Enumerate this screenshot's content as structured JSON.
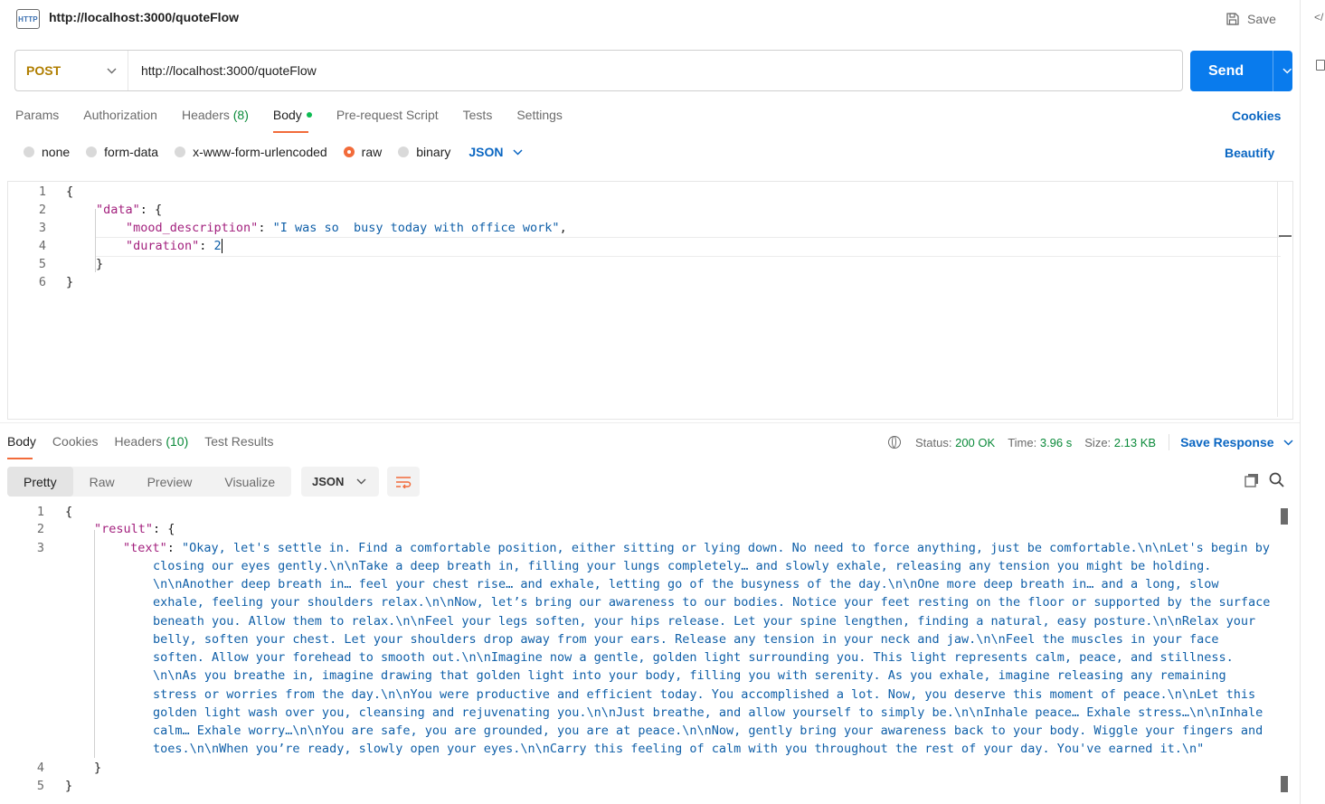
{
  "header": {
    "title": "http://localhost:3000/quoteFlow",
    "save_label": "Save",
    "icon_text": "HTTP"
  },
  "rail": {
    "code_glyph": "</"
  },
  "request": {
    "method": "POST",
    "url": "http://localhost:3000/quoteFlow",
    "send_label": "Send",
    "tabs": [
      {
        "label": "Params"
      },
      {
        "label": "Authorization"
      },
      {
        "label": "Headers",
        "count": "(8)"
      },
      {
        "label": "Body"
      },
      {
        "label": "Pre-request Script"
      },
      {
        "label": "Tests"
      },
      {
        "label": "Settings"
      }
    ],
    "cookies_label": "Cookies",
    "body_types": [
      "none",
      "form-data",
      "x-www-form-urlencoded",
      "raw",
      "binary"
    ],
    "body_format": "JSON",
    "beautify_label": "Beautify"
  },
  "editor": {
    "line_numbers": [
      "1",
      "2",
      "3",
      "4",
      "5",
      "6"
    ],
    "open_brace": "{",
    "data_key": "\"data\"",
    "colon_open": ": {",
    "mood_key": "\"mood_description\"",
    "mood_value": "\"I was so  busy today with office work\"",
    "comma": ",",
    "duration_key": "\"duration\"",
    "duration_value": "2",
    "close_inner": "}",
    "close_outer": "}"
  },
  "response": {
    "tabs": [
      {
        "label": "Body"
      },
      {
        "label": "Cookies"
      },
      {
        "label": "Headers",
        "count": "(10)"
      },
      {
        "label": "Test Results"
      }
    ],
    "status_label": "Status:",
    "status_value": "200 OK",
    "time_label": "Time:",
    "time_value": "3.96 s",
    "size_label": "Size:",
    "size_value": "2.13 KB",
    "save_response_label": "Save Response",
    "views": [
      "Pretty",
      "Raw",
      "Preview",
      "Visualize"
    ],
    "format": "JSON",
    "line_numbers": [
      "1",
      "2",
      "3",
      "4",
      "5"
    ],
    "open_brace": "{",
    "result_key": "\"result\"",
    "colon_open": ": {",
    "text_key": "\"text\"",
    "text_lines": [
      "\"Okay, let's settle in. Find a comfortable position, either sitting or lying down. No need to force anything, just be comfortable.\\n\\nLet's begin by",
      "closing our eyes gently.\\n\\nTake a deep breath in, filling your lungs completely… and slowly exhale, releasing any tension you might be holding.",
      "\\n\\nAnother deep breath in… feel your chest rise… and exhale, letting go of the busyness of the day.\\n\\nOne more deep breath in… and a long, slow",
      "exhale, feeling your shoulders relax.\\n\\nNow, let’s bring our awareness to our bodies. Notice your feet resting on the floor or supported by the surface",
      "beneath you. Allow them to relax.\\n\\nFeel your legs soften, your hips release. Let your spine lengthen, finding a natural, easy posture.\\n\\nRelax your",
      "belly, soften your chest. Let your shoulders drop away from your ears. Release any tension in your neck and jaw.\\n\\nFeel the muscles in your face",
      "soften. Allow your forehead to smooth out.\\n\\nImagine now a gentle, golden light surrounding you. This light represents calm, peace, and stillness.",
      "\\n\\nAs you breathe in, imagine drawing that golden light into your body, filling you with serenity. As you exhale, imagine releasing any remaining",
      "stress or worries from the day.\\n\\nYou were productive and efficient today. You accomplished a lot. Now, you deserve this moment of peace.\\n\\nLet this",
      "golden light wash over you, cleansing and rejuvenating you.\\n\\nJust breathe, and allow yourself to simply be.\\n\\nInhale peace… Exhale stress…\\n\\nInhale",
      "calm… Exhale worry…\\n\\nYou are safe, you are grounded, you are at peace.\\n\\nNow, gently bring your awareness back to your body. Wiggle your fingers and",
      "toes.\\n\\nWhen you’re ready, slowly open your eyes.\\n\\nCarry this feeling of calm with you throughout the rest of your day. You've earned it.\\n\""
    ],
    "close_inner": "}",
    "close_outer": "}"
  },
  "colors": {
    "accent": "#f26b3a",
    "send": "#097bed",
    "link": "#0a66c2",
    "success": "#0b8a3a",
    "method": "#b07e00",
    "json_key": "#a3217e",
    "json_string": "#0f5fa8"
  }
}
